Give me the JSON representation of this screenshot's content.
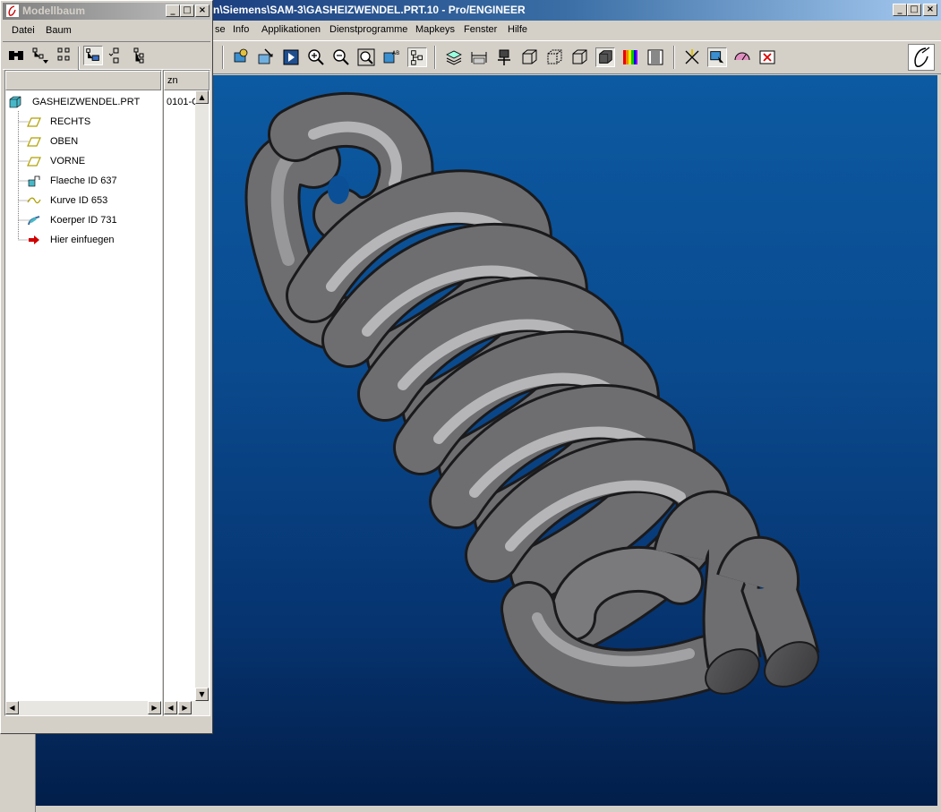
{
  "main_window": {
    "title": "n\\Siemens\\SAM-3\\GASHEIZWENDEL.PRT.10 - Pro/ENGINEER",
    "menu": [
      "se",
      "Info",
      "Applikationen",
      "Dienstprogramme",
      "Mapkeys",
      "Fenster",
      "Hilfe"
    ],
    "controls": {
      "minimize": "_",
      "maximize": "□",
      "close": "×"
    }
  },
  "model_tree": {
    "title": "Modellbaum",
    "menu": [
      "Datei",
      "Baum"
    ],
    "column_header": "zn",
    "column_value": "0101-C",
    "items": [
      {
        "label": "GASHEIZWENDEL.PRT",
        "icon": "part-icon"
      },
      {
        "label": "RECHTS",
        "icon": "datum-plane-icon"
      },
      {
        "label": "OBEN",
        "icon": "datum-plane-icon"
      },
      {
        "label": "VORNE",
        "icon": "datum-plane-icon"
      },
      {
        "label": "Flaeche ID 637",
        "icon": "surface-icon"
      },
      {
        "label": "Kurve ID 653",
        "icon": "curve-icon"
      },
      {
        "label": "Koerper ID 731",
        "icon": "solid-body-icon"
      },
      {
        "label": "Hier einfuegen",
        "icon": "insert-arrow-icon"
      }
    ]
  },
  "colors": {
    "graphics_top": "#0c5aa2",
    "graphics_bottom": "#021e4a",
    "model_gray": "#6e6e70"
  }
}
